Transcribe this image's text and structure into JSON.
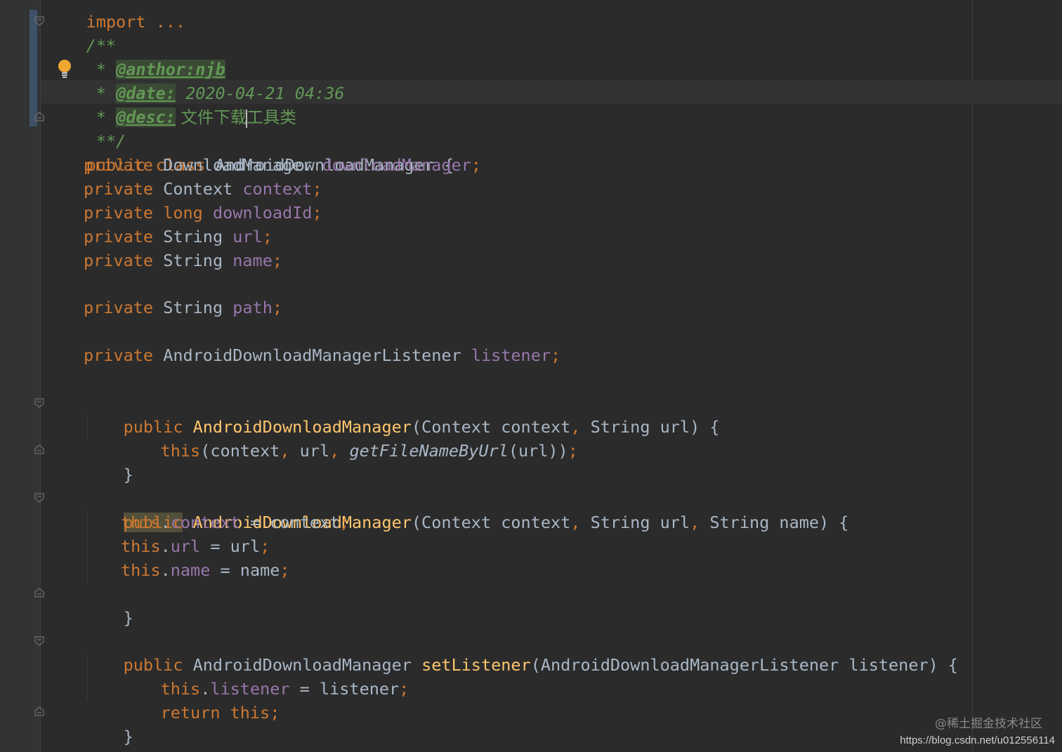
{
  "editor": {
    "language": "java",
    "theme_colors": {
      "background": "#2b2b2b",
      "keyword": "#cc7832",
      "field": "#9876aa",
      "method": "#ffc66d",
      "text": "#a9b7c6",
      "doc_comment": "#629755"
    },
    "import_line": "import ...",
    "doc_comment": {
      "open": "/**",
      "author_prefix": "* ",
      "author_tag": "@anthor:njb",
      "date_prefix": "* ",
      "date_tag": "@date:",
      "date_value": " 2020-04-21 04:36",
      "desc_prefix": "* ",
      "desc_tag": "@desc:",
      "desc_value_before_caret": " 文件下载",
      "desc_value_after_caret": "工具类",
      "close": "**/"
    },
    "class_decl": {
      "kw_public": "public",
      "kw_class": "class",
      "name": "AndroidDownloadManager",
      "brace": "{"
    },
    "fields": [
      {
        "modifier": "private",
        "type": "DownloadManager",
        "name": "downloadManager",
        "type_is_keyword": false
      },
      {
        "modifier": "private",
        "type": "Context",
        "name": "context",
        "type_is_keyword": false
      },
      {
        "modifier": "private",
        "type": "long",
        "name": "downloadId",
        "type_is_keyword": true
      },
      {
        "modifier": "private",
        "type": "String",
        "name": "url",
        "type_is_keyword": false
      },
      {
        "modifier": "private",
        "type": "String",
        "name": "name",
        "type_is_keyword": false
      },
      {
        "modifier": "private",
        "type": "String",
        "name": "path",
        "type_is_keyword": false
      },
      {
        "modifier": "private",
        "type": "AndroidDownloadManagerListener",
        "name": "listener",
        "type_is_keyword": false
      }
    ],
    "ctor1": {
      "kw": "public",
      "name": "AndroidDownloadManager",
      "params_a": "(Context context",
      "params_b": " String url) {",
      "body_this": "this",
      "body_args_a": "(context",
      "body_args_b": " url",
      "body_call": "getFileNameByUrl",
      "body_args_c": "(url))",
      "close": "}"
    },
    "ctor2": {
      "kw": "public",
      "name": "AndroidDownloadManager",
      "params_a": "(Context context",
      "params_b": " String url",
      "params_c": " String name) {",
      "assignments": [
        {
          "field": "context",
          "value": "context"
        },
        {
          "field": "url",
          "value": "url"
        },
        {
          "field": "name",
          "value": "name"
        }
      ],
      "close": "}"
    },
    "setter": {
      "kw": "public",
      "ret_type": "AndroidDownloadManager",
      "name": "setListener",
      "params": "(AndroidDownloadManagerListener listener) {",
      "assign_field": "listener",
      "assign_value": "listener",
      "return_kw": "return",
      "return_val": "this",
      "close": "}"
    },
    "syntax": {
      "this": "this",
      "dot": ".",
      "eq": " = ",
      "semi": ";",
      "comma": ","
    }
  },
  "watermark": {
    "line1": "@稀土掘金技术社区",
    "line2": "https://blog.csdn.net/u012556114"
  }
}
